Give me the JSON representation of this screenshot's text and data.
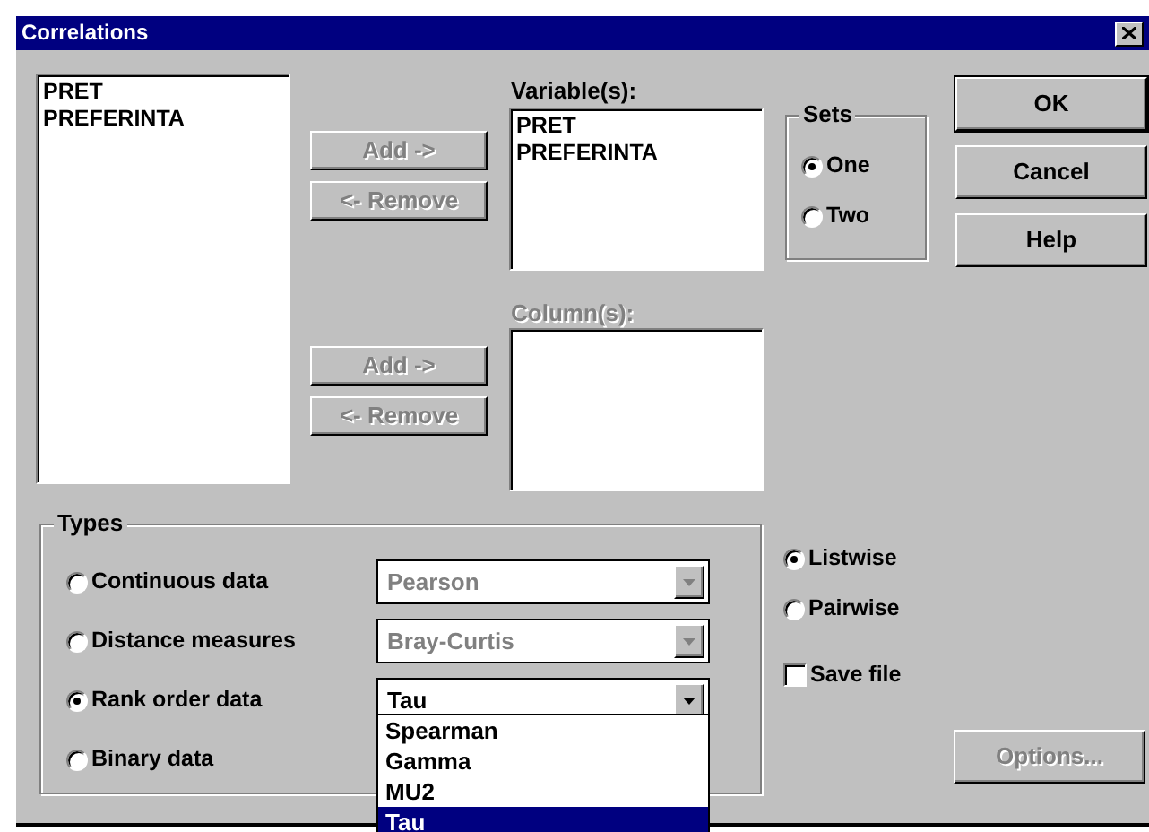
{
  "window": {
    "title": "Correlations"
  },
  "source_list": {
    "items": [
      "PRET",
      "PREFERINTA"
    ]
  },
  "variables": {
    "label": "Variable(s):",
    "disabled": false,
    "items": [
      "PRET",
      "PREFERINTA"
    ],
    "add_button": {
      "label": "Add ->",
      "disabled": true
    },
    "remove_button": {
      "label": "<- Remove",
      "disabled": true
    }
  },
  "columns": {
    "label": "Column(s):",
    "disabled": true,
    "add_button": {
      "label": "Add ->",
      "disabled": true
    },
    "remove_button": {
      "label": "<- Remove",
      "disabled": true
    }
  },
  "sets": {
    "label": "Sets",
    "options": [
      {
        "label": "One",
        "selected": true
      },
      {
        "label": "Two",
        "selected": false
      }
    ]
  },
  "buttons": [
    {
      "label": "OK",
      "default": true
    },
    {
      "label": "Cancel",
      "default": false
    },
    {
      "label": "Help",
      "default": false
    }
  ],
  "types": {
    "label": "Types",
    "rows": [
      {
        "label": "Continuous data",
        "selected": false,
        "combo": {
          "value": "Pearson",
          "disabled": true
        }
      },
      {
        "label": "Distance measures",
        "selected": false,
        "combo": {
          "value": "Bray-Curtis",
          "disabled": true
        }
      },
      {
        "label": "Rank order data",
        "selected": true,
        "combo": {
          "value": "Tau",
          "disabled": false,
          "open": true,
          "options": [
            {
              "label": "Spearman",
              "selected": false
            },
            {
              "label": "Gamma",
              "selected": false
            },
            {
              "label": "MU2",
              "selected": false
            },
            {
              "label": "Tau",
              "selected": true
            }
          ]
        }
      },
      {
        "label": "Binary data",
        "selected": false
      }
    ]
  },
  "missing": {
    "options": [
      {
        "label": "Listwise",
        "selected": true
      },
      {
        "label": "Pairwise",
        "selected": false
      }
    ]
  },
  "save_file": {
    "label": "Save file",
    "checked": false
  },
  "options_button": {
    "label": "Options...",
    "disabled": true
  }
}
